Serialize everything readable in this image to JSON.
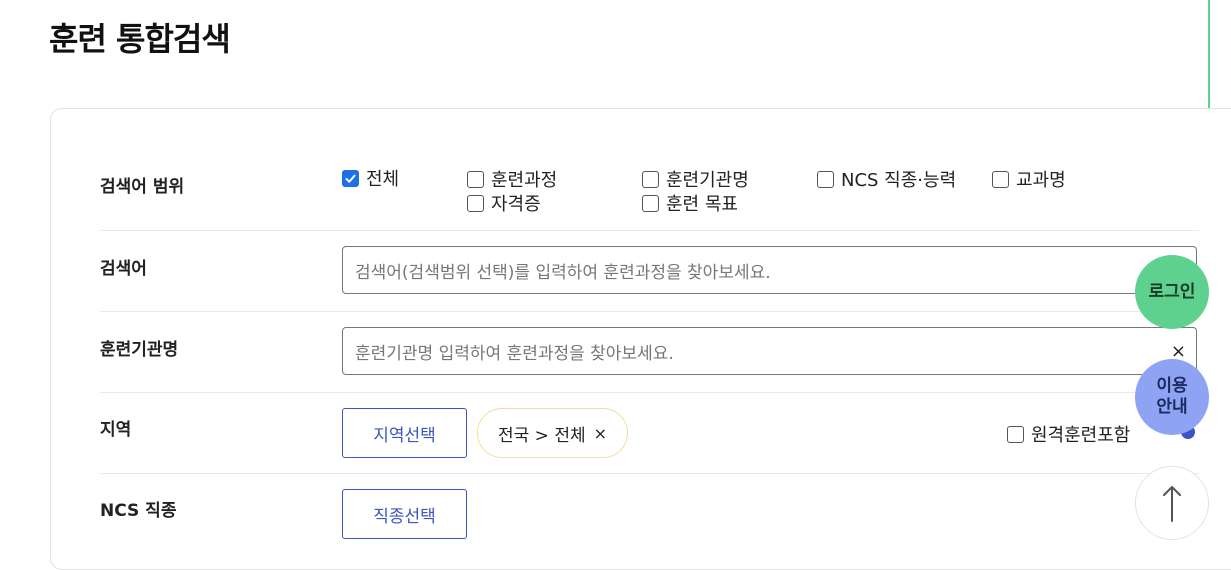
{
  "page": {
    "title": "훈련 통합검색"
  },
  "search_scope": {
    "label": "검색어 범위",
    "options": [
      {
        "label": "전체",
        "checked": true
      },
      {
        "label": "훈련과정",
        "checked": false
      },
      {
        "label": "훈련기관명",
        "checked": false
      },
      {
        "label": "NCS 직종·능력",
        "checked": false
      },
      {
        "label": "교과명",
        "checked": false
      },
      {
        "label": "자격증",
        "checked": false
      },
      {
        "label": "훈련 목표",
        "checked": false
      }
    ]
  },
  "keyword": {
    "label": "검색어",
    "placeholder": "검색어(검색범위 선택)를 입력하여 훈련과정을 찾아보세요."
  },
  "institution": {
    "label": "훈련기관명",
    "placeholder": "훈련기관명 입력하여 훈련과정을 찾아보세요.",
    "clear": "×"
  },
  "region": {
    "label": "지역",
    "button": "지역선택",
    "chip": "전국 > 전체",
    "chip_remove": "×",
    "remote_label": "원격훈련포함",
    "remote_checked": false
  },
  "ncs": {
    "label": "NCS 직종",
    "button": "직종선택"
  },
  "floating": {
    "login": "로그인",
    "guide_line1": "이용",
    "guide_line2": "안내",
    "top": "↑"
  },
  "colors": {
    "accent_blue": "#3b55c4",
    "check_blue": "#1f6fe5",
    "login_green": "#5fd18e",
    "guide_blue": "#8ea3f4",
    "chip_border": "#f1df9a"
  }
}
